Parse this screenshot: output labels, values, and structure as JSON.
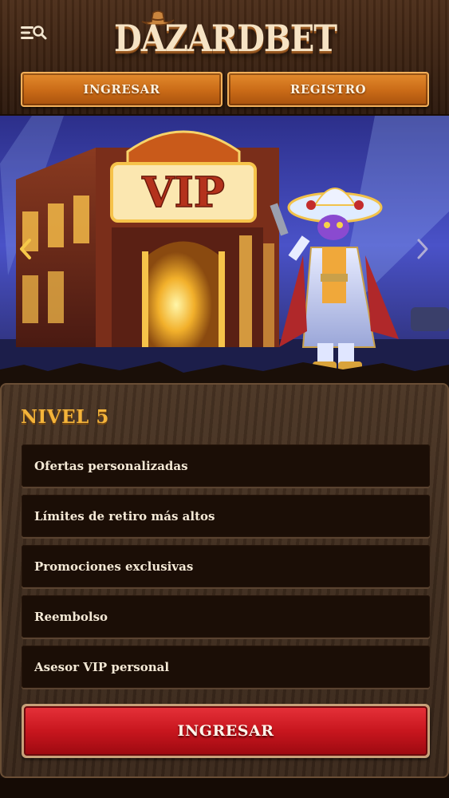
{
  "header": {
    "logo_text": "DAZARDBET",
    "login_label": "INGRESAR",
    "register_label": "REGISTRO"
  },
  "banner": {
    "sign_text": "VIP"
  },
  "vip_level": {
    "title": "NIVEL 5",
    "benefits": [
      "Ofertas personalizadas",
      "Límites de retiro más altos",
      "Promociones exclusivas",
      "Reembolso",
      "Asesor VIP personal"
    ],
    "cta_label": "INGRESAR"
  },
  "icons": {
    "menu": "menu-search-icon",
    "prev": "chevron-left-icon",
    "next": "chevron-right-icon"
  },
  "colors": {
    "accent_orange": "#d6771f",
    "title_gold": "#f4b43a",
    "cta_red": "#c8161e"
  }
}
